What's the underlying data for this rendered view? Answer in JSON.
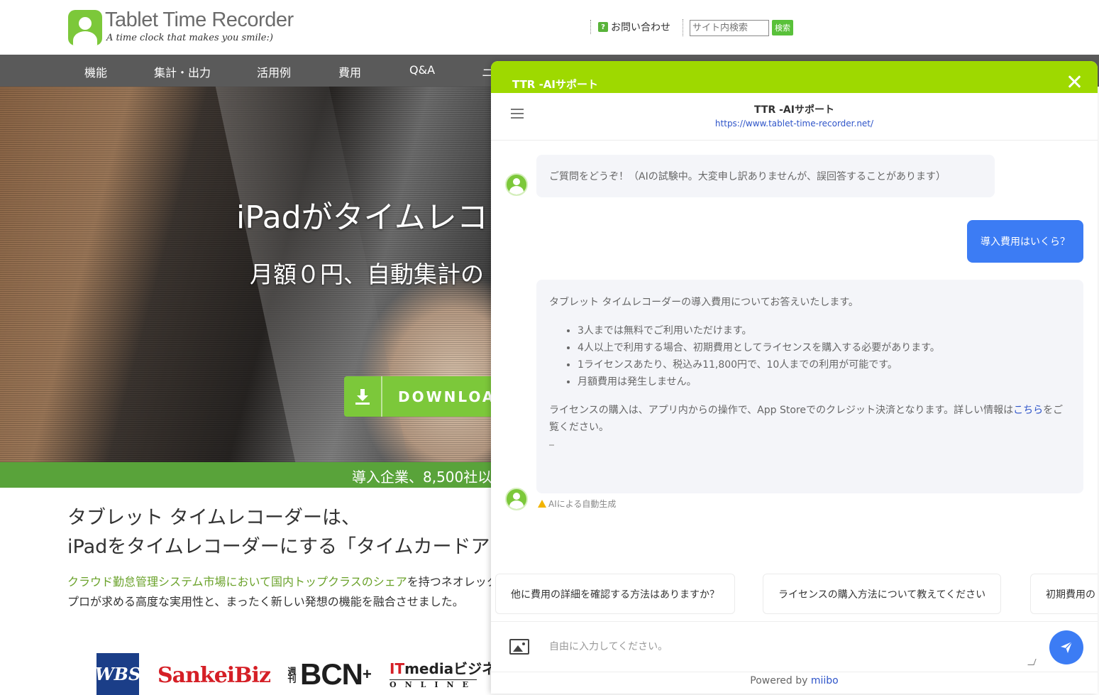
{
  "site": {
    "logo_title": "Tablet Time Recorder",
    "logo_tagline": "A time clock that makes you smile:)",
    "contact_label": "お問い合わせ",
    "search_placeholder": "サイト内検索",
    "search_button": "検索",
    "nav": [
      "機能",
      "集計・出力",
      "活用例",
      "費用",
      "Q&A",
      "ニ"
    ],
    "hero_title": "iPadがタイムレコ",
    "hero_subtitle": "月額０円、自動集計の",
    "download_label": "DOWNLOAD",
    "band_text": "導入企業、8,500社以",
    "intro_line1": "タブレット タイムレコーダーは、",
    "intro_line2": "iPadをタイムレコーダーにする「タイムカードア",
    "desc_link": "クラウド勤怠管理システム市場において国内トップクラスのシェア",
    "desc_rest": "を持つネオレック",
    "desc_line2": "プロが求める高度な実用性と、まったく新しい発想の機能を融合させました。",
    "media": {
      "wbs": "WBS",
      "sankei": "SankeiBiz",
      "bcn_prefix": "週刊",
      "bcn": "BCN",
      "bcn_plus": "+",
      "itmedia_it": "IT",
      "itmedia_rest": "mediaビジネス",
      "itmedia_online": "ONLINE"
    }
  },
  "chat": {
    "topbar_title": "TTR -AIサポート",
    "header_title": "TTR -AIサポート",
    "header_url": "https://www.tablet-time-recorder.net/",
    "greeting": "ご質問をどうぞ！（AIの試験中。大変申し訳ありませんが、誤回答することがあります）",
    "user_message": "導入費用はいくら？",
    "answer": {
      "intro": "タブレット タイムレコーダーの導入費用についてお答えいたします。",
      "bullets": [
        "3人までは無料でご利用いただけます。",
        "4人以上で利用する場合、初期費用としてライセンスを購入する必要があります。",
        "1ライセンスあたり、税込み11,800円で、10人までの利用が可能です。",
        "月額費用は発生しません。"
      ],
      "outro_before": "ライセンスの購入は、アプリ内からの操作で、App Storeでのクレジット決済となります。詳しい情報は",
      "outro_link": "こちら",
      "outro_after": "をご覧ください。"
    },
    "ai_note": "AIによる自動生成",
    "suggestions": [
      "他に費用の詳細を確認する方法はありますか？",
      "ライセンスの購入方法について教えてください",
      "初期費用の"
    ],
    "input_placeholder": "自由に入力してください。",
    "powered_by": "Powered by ",
    "powered_brand": "miibo"
  },
  "colors": {
    "chat_topbar": "#9ed900",
    "user_bubble": "#3c7cf4",
    "site_green": "#7cc83a",
    "nav_bar": "#5a5a5a"
  },
  "icons": [
    "logo-icon",
    "question-icon",
    "download-icon",
    "close-icon",
    "hamburger-icon",
    "avatar-icon",
    "warning-icon",
    "image-icon",
    "send-icon"
  ]
}
